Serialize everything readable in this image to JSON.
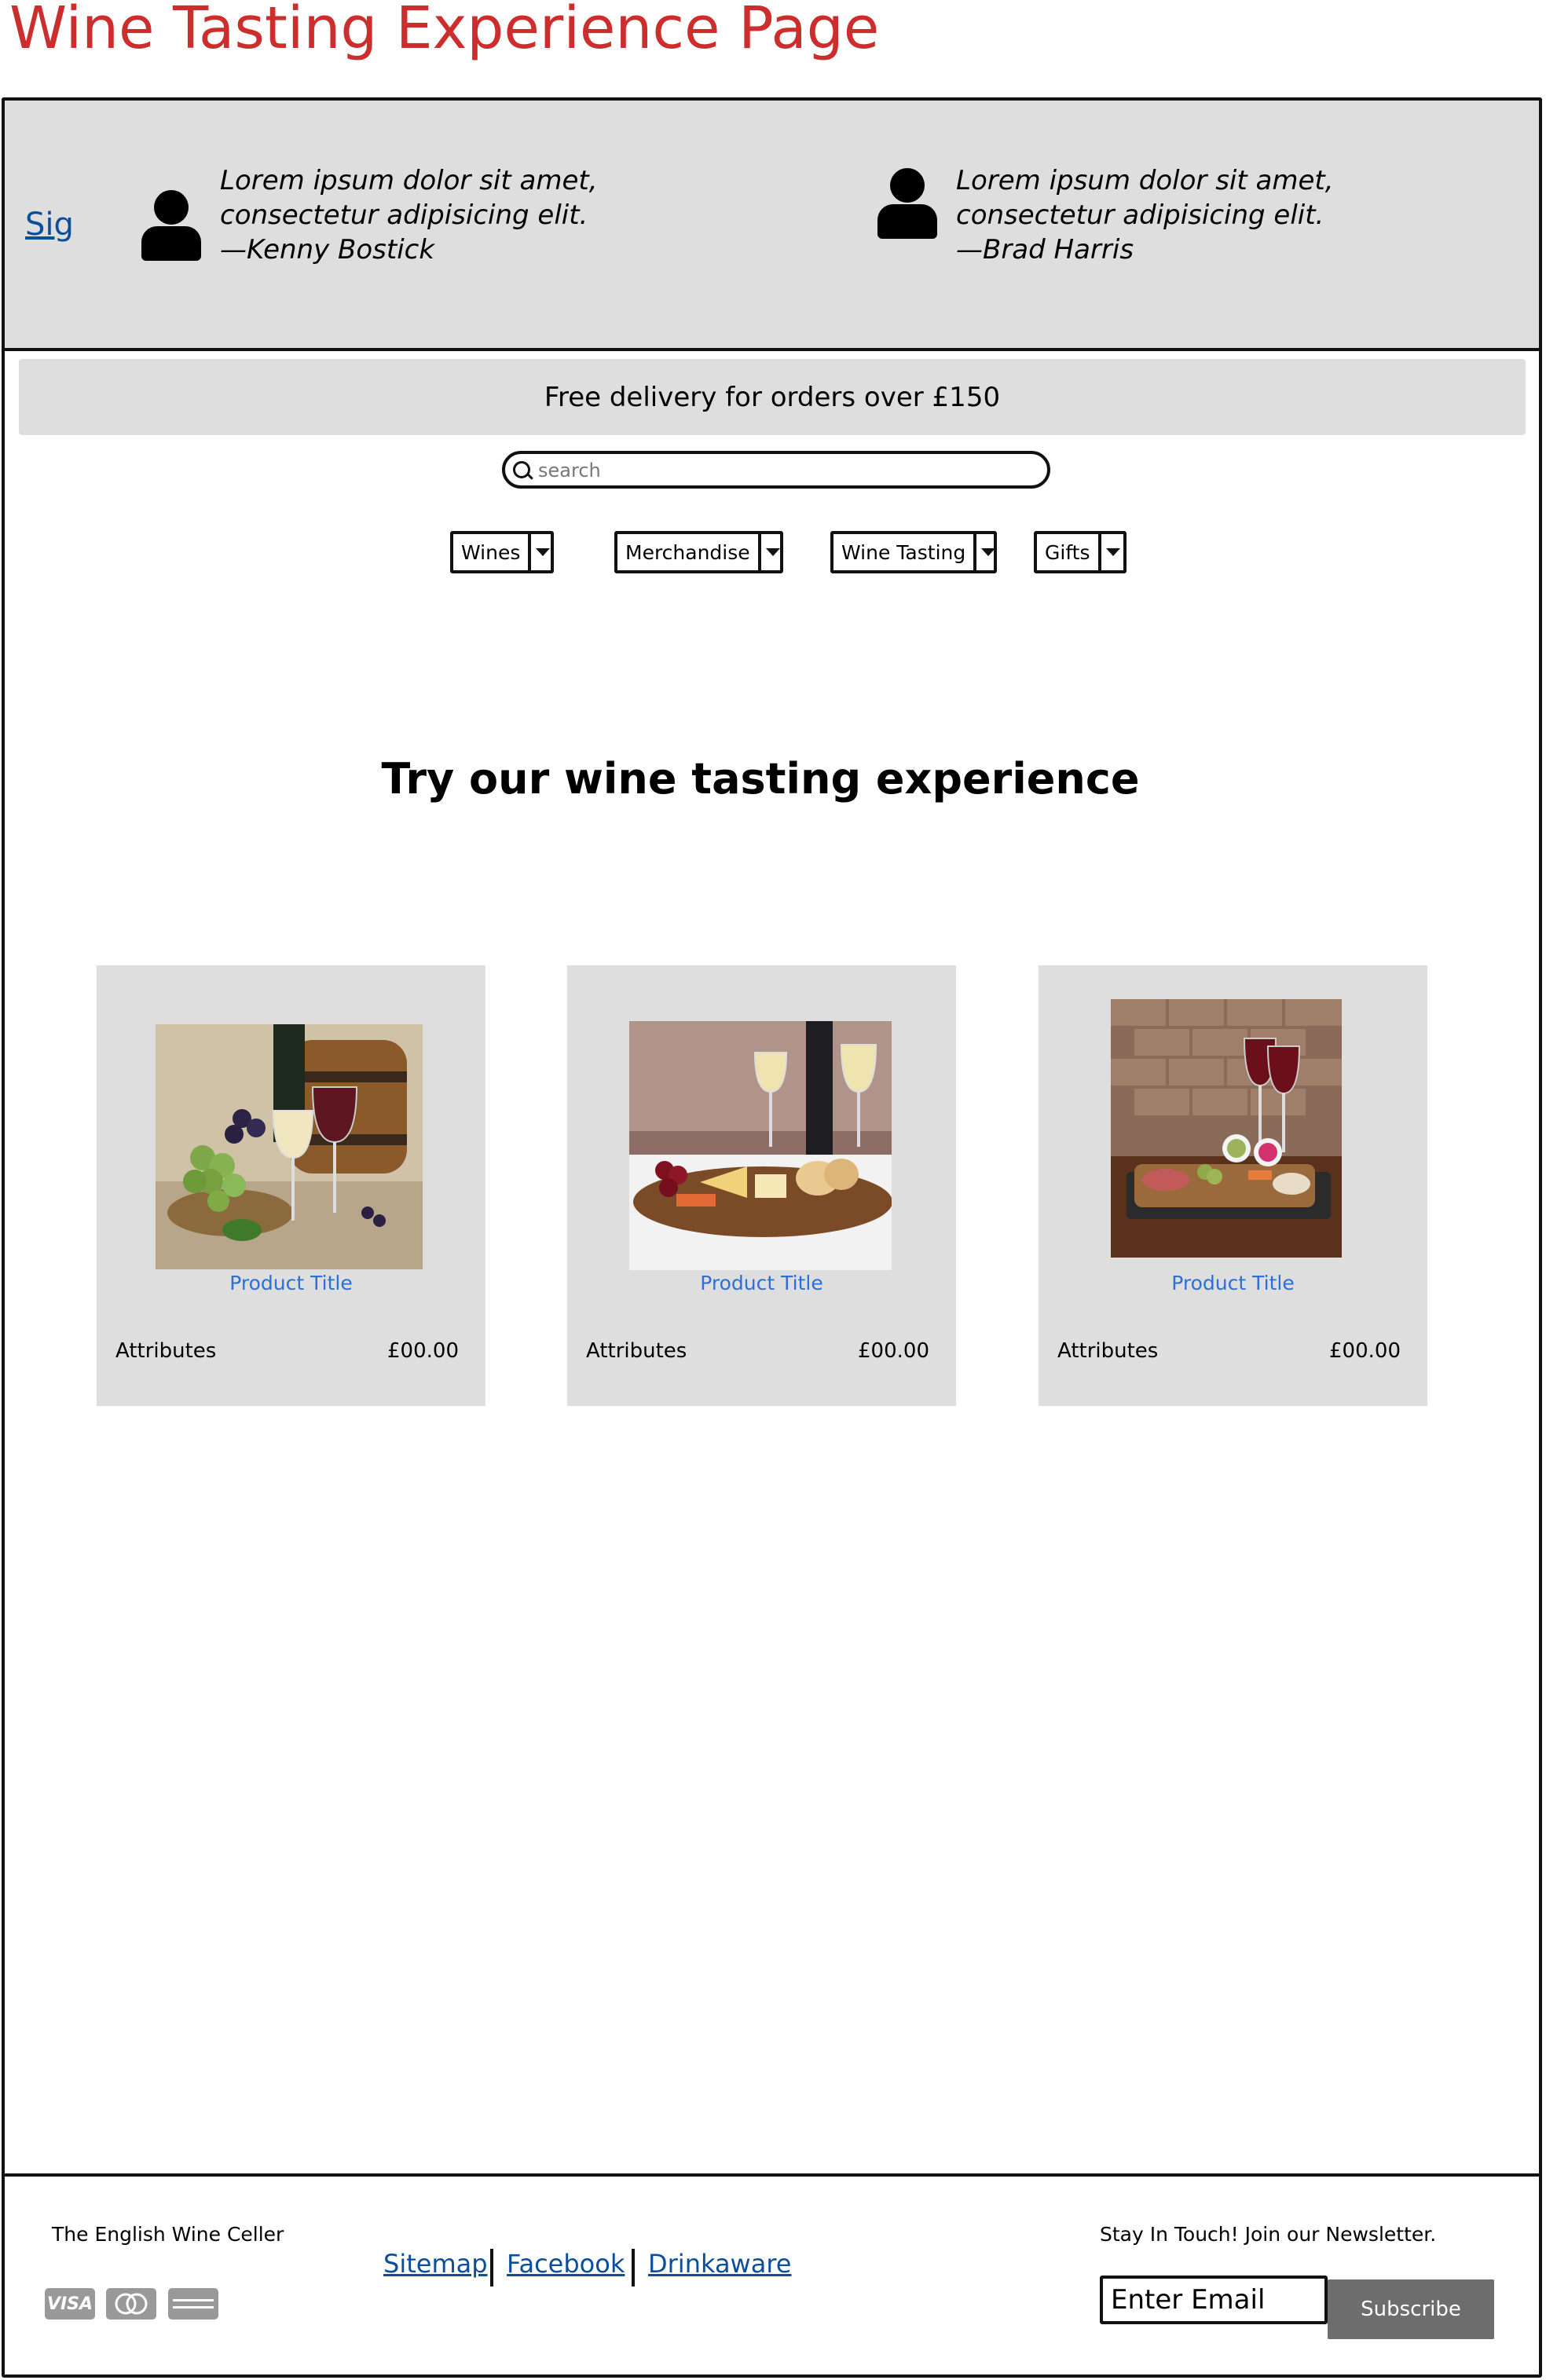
{
  "page_title": "Wine Tasting Experience Page",
  "header": {
    "signin_link": "Sig",
    "testimonials": [
      {
        "line1": "Lorem ipsum dolor sit amet,",
        "line2": "consectetur adipisicing elit.",
        "author": "—Kenny Bostick"
      },
      {
        "line1": "Lorem ipsum dolor sit amet,",
        "line2": "consectetur adipisicing elit.",
        "author": "—Brad Harris"
      }
    ]
  },
  "banner": {
    "text": "Free delivery for orders over £150"
  },
  "search": {
    "placeholder": "search"
  },
  "nav": {
    "items": [
      {
        "label": "Wines"
      },
      {
        "label": "Merchandise"
      },
      {
        "label": "Wine Tasting"
      },
      {
        "label": "Gifts"
      }
    ]
  },
  "main": {
    "heading": "Try our wine tasting experience",
    "products": [
      {
        "title": "Product Title",
        "attributes": "Attributes",
        "price": "£00.00",
        "image": "grapes-wine-barrel-photo"
      },
      {
        "title": "Product Title",
        "attributes": "Attributes",
        "price": "£00.00",
        "image": "cheese-board-wine-photo"
      },
      {
        "title": "Product Title",
        "attributes": "Attributes",
        "price": "£00.00",
        "image": "charcuterie-board-wine-photo"
      }
    ]
  },
  "footer": {
    "brand": "The English Wine Celler",
    "payment_icons": [
      "visa-icon",
      "mastercard-icon",
      "american-express-icon"
    ],
    "payment_text": {
      "visa": "VISA"
    },
    "links": [
      "Sitemap",
      "Facebook",
      "Drinkaware"
    ],
    "newsletter": {
      "label": "Stay In Touch! Join our Newsletter.",
      "email_placeholder": "Enter Email",
      "subscribe_label": "Subscribe"
    }
  },
  "colors": {
    "title_red": "#cc2e2e",
    "link_blue": "#0b4f9c",
    "product_title_blue": "#2c6fd6",
    "panel_gray": "#dedede",
    "button_gray": "#6d6d6d"
  }
}
